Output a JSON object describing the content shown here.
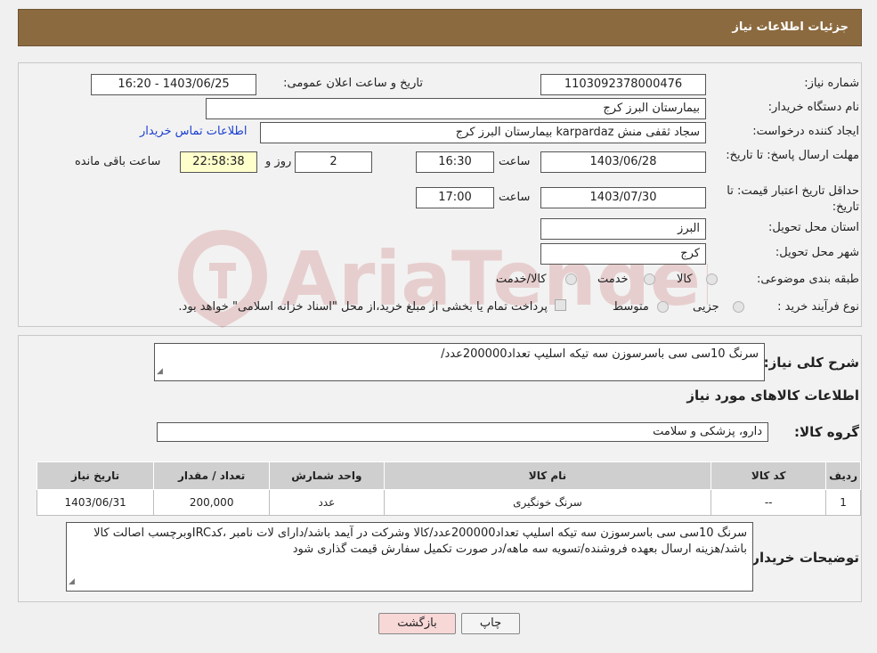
{
  "header": {
    "title": "جزئیات اطلاعات نیاز"
  },
  "fields": {
    "need_number_label": "شماره نیاز:",
    "need_number": "1103092378000476",
    "announce_label": "تاریخ و ساعت اعلان عمومی:",
    "announce_value": "1403/06/25 - 16:20",
    "buyer_label": "نام دستگاه خریدار:",
    "buyer_value": "بیمارستان البرز کرج",
    "creator_label": "ایجاد کننده درخواست:",
    "creator_value": "سجاد ثقفی منش karpardaz بیمارستان البرز کرج",
    "contact_link": "اطلاعات تماس خریدار",
    "deadline_label": "مهلت ارسال پاسخ: تا تاریخ:",
    "deadline_date": "1403/06/28",
    "time_label": "ساعت",
    "deadline_time": "16:30",
    "days_value": "2",
    "days_label": "روز و",
    "remaining_value": "22:58:38",
    "remaining_label": "ساعت باقی مانده",
    "validity_label": "حداقل تاریخ اعتبار قیمت: تا تاریخ:",
    "validity_date": "1403/07/30",
    "validity_time": "17:00",
    "province_label": "استان محل تحویل:",
    "province_value": "البرز",
    "city_label": "شهر محل تحویل:",
    "city_value": "کرج",
    "category_label": "طبقه بندی موضوعی:",
    "cat_goods": "کالا",
    "cat_service": "خدمت",
    "cat_both": "کالا/خدمت",
    "process_label": "نوع فرآیند خرید :",
    "proc_partial": "جزیی",
    "proc_medium": "متوسط",
    "proc_note": "پرداخت تمام یا بخشی از مبلغ خرید،از محل \"اسناد خزانه اسلامی\" خواهد بود."
  },
  "details": {
    "summary_label": "شرح کلی نیاز:",
    "summary_value": "سرنگ 10سی سی باسرسوزن سه تیکه اسلیپ تعداد200000عدد/",
    "goods_info_title": "اطلاعات کالاهای مورد نیاز",
    "group_label": "گروه کالا:",
    "group_value": "دارو، پزشکی و سلامت",
    "table": {
      "headers": [
        "ردیف",
        "کد کالا",
        "نام کالا",
        "واحد شمارش",
        "تعداد / مقدار",
        "تاریخ نیاز"
      ],
      "rows": [
        [
          "1",
          "--",
          "سرنگ خونگیری",
          "عدد",
          "200,000",
          "1403/06/31"
        ]
      ]
    },
    "buyer_notes_label": "توضیحات خریدار:",
    "buyer_notes_value": "سرنگ 10سی سی باسرسوزن سه تیکه اسلیپ تعداد200000عدد/کالا وشرکت در آیمد باشد/دارای لات نامبر ،کدIRCوبرچسب اصالت کالا باشد/هزینه ارسال بعهده فروشنده/تسویه سه ماهه/در صورت تکمیل سفارش قیمت گذاری شود"
  },
  "buttons": {
    "print": "چاپ",
    "back": "بازگشت"
  },
  "watermark": {
    "text": "AriaTender.neT"
  },
  "colors": {
    "header_bg": "#8b6a3f",
    "link": "#1a3fd0",
    "back_btn_bg": "#f8d7d7",
    "yellow_box": "#ffffcc"
  }
}
